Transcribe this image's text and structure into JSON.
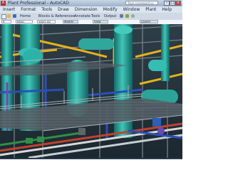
{
  "window": {
    "title": "Plant Professional - AutoCAD",
    "search_placeholder": "Type a keyword or phrase",
    "controls": {
      "minimize": "–",
      "maximize": "□",
      "close": "×"
    }
  },
  "menubar": {
    "items": [
      "Insert",
      "Format",
      "Tools",
      "Draw",
      "Dimension",
      "Modify",
      "Window",
      "Plant",
      "Help"
    ]
  },
  "toolbar": {
    "tabs": [
      "Home",
      "Blocks & References",
      "Annotate",
      "Tools",
      "Output"
    ],
    "icons": [
      "new-file-icon",
      "open-folder-icon",
      "save-icon",
      "undo-icon",
      "layer-icon",
      "gear-icon"
    ]
  },
  "properties_bar": {
    "layer": "0",
    "style": "Basic",
    "linetype": "Solid 3D",
    "modify": "Modify",
    "view": "View",
    "layers": "Layers"
  },
  "colors": {
    "tank": "#22a49c",
    "tank_light": "#4fd3c6",
    "steel": "#9aa1a6",
    "steel_dark": "#5e666c",
    "pipe_yellow": "#e6b21c",
    "pipe_blue": "#2c4fb8",
    "pipe_purple": "#7f3fb5",
    "pipe_red": "#c2412f",
    "pipe_green": "#2f8f46",
    "floor": "#2b3b45"
  }
}
